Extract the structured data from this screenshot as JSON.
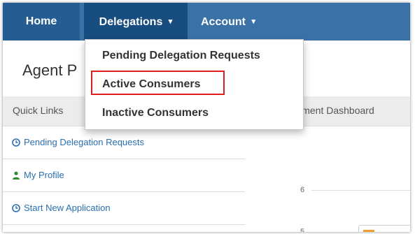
{
  "navbar": {
    "home": "Home",
    "delegations": "Delegations",
    "account": "Account",
    "caret_glyph": "▾"
  },
  "page": {
    "title": "Agent P",
    "quick_links_header": "Quick Links",
    "dashboard_label": "llment Dashboard"
  },
  "sidebar": {
    "items": [
      {
        "label": "Pending Delegation Requests",
        "icon": "clock-icon"
      },
      {
        "label": "My Profile",
        "icon": "user-icon"
      },
      {
        "label": "Start New Application",
        "icon": "clock-icon"
      }
    ]
  },
  "chart": {
    "tick_6": "6",
    "tick_5": "5"
  },
  "dropdown": {
    "items": [
      {
        "label": "Pending Delegation Requests"
      },
      {
        "label": "Active Consumers",
        "highlighted": true
      },
      {
        "label": "Inactive Consumers"
      }
    ],
    "highlight_color": "#e01e1e"
  },
  "colors": {
    "navbar": "#3a72a8",
    "navbar_active": "#184d80",
    "navbar_home": "#255d93",
    "link": "#2a6fb0",
    "user_icon": "#2e8b2e"
  }
}
